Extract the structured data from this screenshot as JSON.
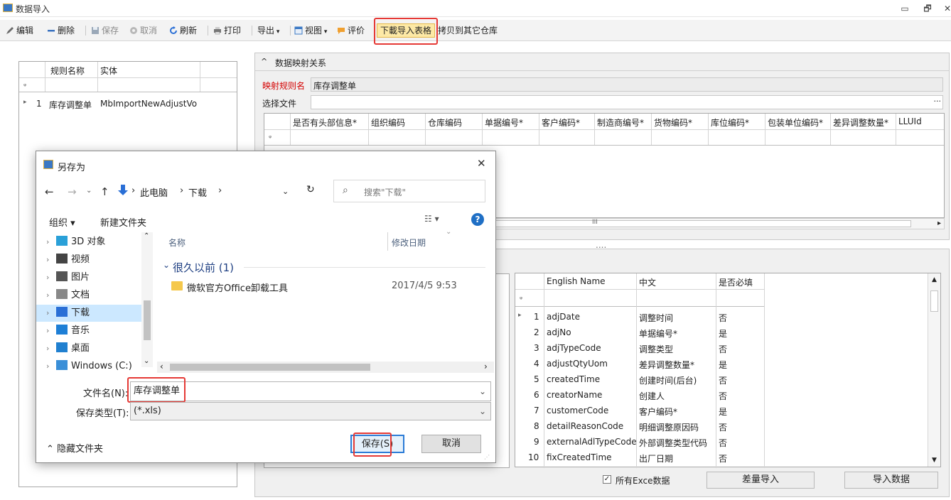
{
  "window": {
    "title": "数据导入"
  },
  "toolbar": {
    "edit": "编辑",
    "delete": "删除",
    "save": "保存",
    "cancel": "取消",
    "refresh": "刷新",
    "print": "打印",
    "export": "导出",
    "view": "视图",
    "rate": "评价",
    "download_template": "下載导入表格",
    "copy_to_other": "拷贝到其它仓库"
  },
  "rules_grid": {
    "columns": [
      "规则名称",
      "实体"
    ],
    "filter_symbol": "ᵩ",
    "rows": [
      {
        "index": "1",
        "name": "库存调整单",
        "entity": "MbImportNewAdjustVo"
      }
    ]
  },
  "mapping": {
    "group_title": "数据映射关系",
    "rule_name_label": "映射规则名",
    "rule_name_value": "库存调整单",
    "select_file_label": "选择文件",
    "browse": "···",
    "columns": [
      "是否有头部信息*",
      "组织编码",
      "仓库编码",
      "单据编号*",
      "客户编码*",
      "制造商编号*",
      "货物编码*",
      "库位编码*",
      "包装单位编码*",
      "差异调整数量*",
      "LLUId"
    ],
    "scroll_grip": "III",
    "splitter": "....",
    "collapse": "^"
  },
  "fields_grid": {
    "columns": [
      "English Name",
      "中文",
      "是否必填"
    ],
    "rows": [
      {
        "no": "1",
        "en": "adjDate",
        "cn": "调整时间",
        "req": "否"
      },
      {
        "no": "2",
        "en": "adjNo",
        "cn": "单据编号*",
        "req": "是"
      },
      {
        "no": "3",
        "en": "adjTypeCode",
        "cn": "调整类型",
        "req": "否"
      },
      {
        "no": "4",
        "en": "adjustQtyUom",
        "cn": "差异调整数量*",
        "req": "是"
      },
      {
        "no": "5",
        "en": "createdTime",
        "cn": "创建时间(后台)",
        "req": "否"
      },
      {
        "no": "6",
        "en": "creatorName",
        "cn": "创建人",
        "req": "否"
      },
      {
        "no": "7",
        "en": "customerCode",
        "cn": "客户编码*",
        "req": "是"
      },
      {
        "no": "8",
        "en": "detailReasonCode",
        "cn": "明细调整原因码",
        "req": "否"
      },
      {
        "no": "9",
        "en": "externalAdlTypeCode",
        "cn": "外部调整类型代码",
        "req": "否"
      },
      {
        "no": "10",
        "en": "fixCreatedTime",
        "cn": "出厂日期",
        "req": "否"
      }
    ]
  },
  "bottom": {
    "all_excel_label": "所有Exce数据",
    "diff_import": "差量导入",
    "import_data": "导入数据"
  },
  "dialog": {
    "title": "另存为",
    "breadcrumb": [
      "此电脑",
      "下载"
    ],
    "search_placeholder": "搜索\"下载\"",
    "organize": "组织 ▾",
    "new_folder": "新建文件夹",
    "help": "?",
    "nav_items": [
      {
        "label": "3D 对象",
        "icon": "cube-icon",
        "color": "#2aa0d8"
      },
      {
        "label": "视频",
        "icon": "video-icon",
        "color": "#444444"
      },
      {
        "label": "图片",
        "icon": "picture-icon",
        "color": "#555555"
      },
      {
        "label": "文档",
        "icon": "document-icon",
        "color": "#888888"
      },
      {
        "label": "下载",
        "icon": "download-icon",
        "color": "#2a6fd6"
      },
      {
        "label": "音乐",
        "icon": "music-icon",
        "color": "#1e7fd6"
      },
      {
        "label": "桌面",
        "icon": "desktop-icon",
        "color": "#2080d0"
      },
      {
        "label": "Windows (C:)",
        "icon": "drive-icon",
        "color": "#3a8fd8"
      }
    ],
    "col_name": "名称",
    "col_modified": "修改日期",
    "group_label": "很久以前 (1)",
    "files": [
      {
        "name": "微软官方Office卸载工具",
        "modified": "2017/4/5 9:53"
      }
    ],
    "filename_label": "文件名(N):",
    "filename_value": "库存调整单",
    "filetype_label": "保存类型(T):",
    "filetype_value": "(*.xls)",
    "hide_folders": "隐藏文件夹",
    "save": "保存(S)",
    "cancel": "取消"
  }
}
